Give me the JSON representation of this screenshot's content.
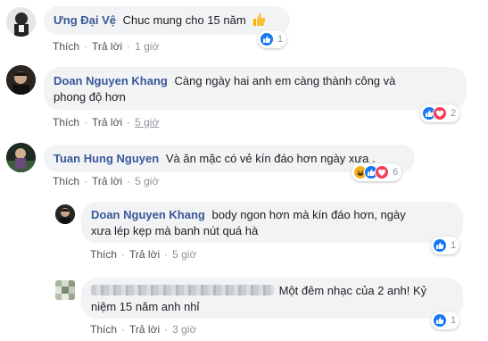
{
  "comments": [
    {
      "author": "Ưng Đại Vệ",
      "text": "Chuc mung cho 15 năm",
      "emoji_icon": "thumbs-up-emoji-icon",
      "like_label": "Thích",
      "reply_label": "Trả lời",
      "time": "1 giờ",
      "reactions": [
        "like"
      ],
      "reaction_count": "1"
    },
    {
      "author": "Doan Nguyen Khang",
      "text_line1": "Càng ngày hai anh em càng thành công và",
      "text_line2": "phong độ hơn",
      "like_label": "Thích",
      "reply_label": "Trả lời",
      "time": "5 giờ",
      "reactions": [
        "like",
        "love"
      ],
      "reaction_count": "2"
    },
    {
      "author": "Tuan Hung Nguyen",
      "text": "Và ăn mặc có vẻ kín đáo hơn ngày xưa .",
      "like_label": "Thích",
      "reply_label": "Trả lời",
      "time": "5 giờ",
      "reactions": [
        "haha",
        "like",
        "love"
      ],
      "reaction_count": "6"
    }
  ],
  "replies": [
    {
      "author": "Doan Nguyen Khang",
      "text_line1": "body ngon hơn mà kín đáo hơn, ngày",
      "text_line2": "xưa lép kẹp mà banh nút quá hà",
      "like_label": "Thích",
      "reply_label": "Trả lời",
      "time": "5 giờ",
      "reactions": [
        "like"
      ],
      "reaction_count": "1"
    },
    {
      "author": "",
      "text_line1": "Một đêm nhạc của 2 anh! Kỷ",
      "text_line2": "niệm 15 năm anh nhỉ",
      "like_label": "Thích",
      "reply_label": "Trả lời",
      "time": "3 giờ",
      "reactions": [
        "like"
      ],
      "reaction_count": "1"
    }
  ],
  "colors": {
    "name": "#385898",
    "like": "#1877f2",
    "love": "#f33e58",
    "haha": "#f7b125",
    "bubble": "#f2f3f5"
  }
}
